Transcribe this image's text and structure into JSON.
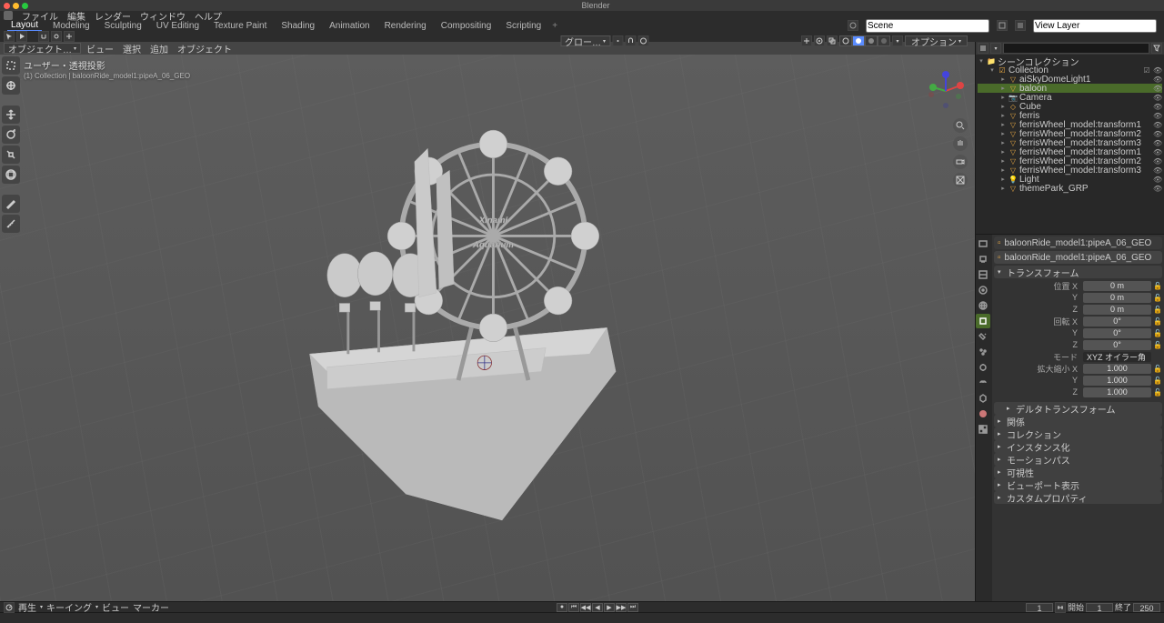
{
  "app": {
    "title": "Blender"
  },
  "menu": {
    "file": "ファイル",
    "edit": "編集",
    "render": "レンダー",
    "window": "ウィンドウ",
    "help": "ヘルプ"
  },
  "workspaces": [
    "Layout",
    "Modeling",
    "Sculpting",
    "UV Editing",
    "Texture Paint",
    "Shading",
    "Animation",
    "Rendering",
    "Compositing",
    "Scripting"
  ],
  "workspace_plus": "+",
  "scene": {
    "label": "Scene",
    "viewLayer": "View Layer"
  },
  "vp": {
    "modeLabel": "オブジェクト…",
    "headerMenus": [
      "ビュー",
      "選択",
      "追加",
      "オブジェクト"
    ],
    "global": "グロー…",
    "options": "オプション",
    "infoLine1": "ユーザー・透視投影",
    "infoLine2": "(1) Collection | baloonRide_model1:pipeA_06_GEO"
  },
  "outliner": {
    "root": "シーンコレクション",
    "collection": "Collection",
    "items": [
      "aiSkyDomeLight1",
      "baloon",
      "Camera",
      "Cube",
      "ferris",
      "ferrisWheel_model:transform1",
      "ferrisWheel_model:transform2",
      "ferrisWheel_model:transform3",
      "ferrisWheel_model:transform1",
      "ferrisWheel_model:transform2",
      "ferrisWheel_model:transform3",
      "Light",
      "themePark_GRP"
    ]
  },
  "props": {
    "breadcrumb": "baloonRide_model1:pipeA_06_GEO",
    "objectName": "baloonRide_model1:pipeA_06_GEO",
    "transform": "トランスフォーム",
    "location": {
      "label": "位置 X",
      "x": "0 m",
      "y": "0 m",
      "z": "0 m"
    },
    "rotation": {
      "label": "回転 X",
      "x": "0°",
      "y": "0°",
      "z": "0°"
    },
    "mode": {
      "label": "モード",
      "value": "XYZ オイラー角"
    },
    "scale": {
      "label": "拡大縮小 X",
      "x": "1.000",
      "y": "1.000",
      "z": "1.000"
    },
    "deltaTransform": "デルタトランスフォーム",
    "sections": [
      "関係",
      "コレクション",
      "インスタンス化",
      "モーションパス",
      "可視性",
      "ビューポート表示",
      "カスタムプロパティ"
    ]
  },
  "timeline": {
    "playback": "再生",
    "keying": "キーイング",
    "view": "ビュー",
    "marker": "マーカー",
    "current": "1",
    "startLabel": "開始",
    "start": "1",
    "endLabel": "終了",
    "end": "250"
  }
}
